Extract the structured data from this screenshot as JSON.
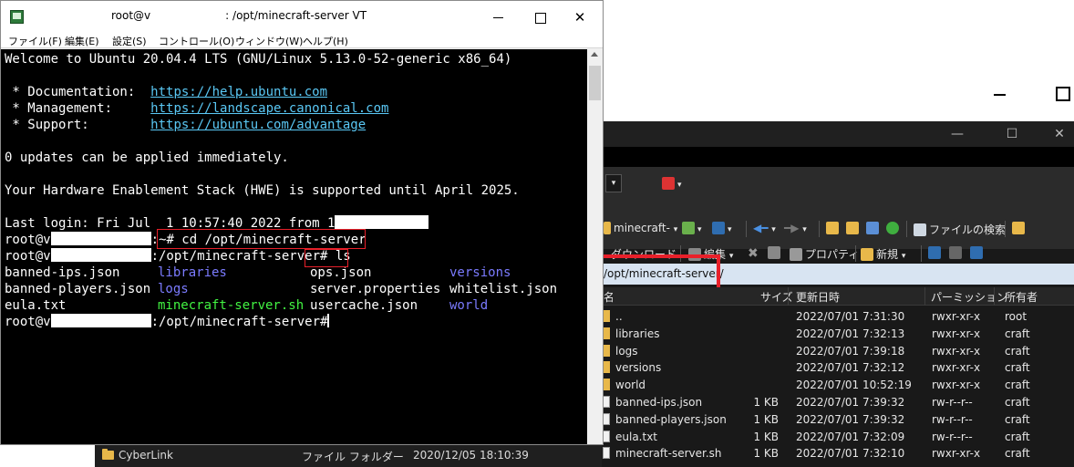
{
  "terminal": {
    "title_prefix": "root@v",
    "title_suffix": ": /opt/minecraft-server VT",
    "menu": [
      "ファイル(F)",
      "編集(E)",
      "設定(S)",
      "コントロール(O)",
      "ウィンドウ(W)",
      "ヘルプ(H)"
    ],
    "close_glyph": "✕",
    "welcome": "Welcome to Ubuntu 20.04.4 LTS (GNU/Linux 5.13.0-52-generic x86_64)",
    "docs_label": " * Documentation:  ",
    "docs_url": "https://help.ubuntu.com",
    "mgmt_label": " * Management:     ",
    "mgmt_url": "https://landscape.canonical.com",
    "support_label": " * Support:        ",
    "support_url": "https://ubuntu.com/advantage",
    "updates": "0 updates can be applied immediately.",
    "hwe": "Your Hardware Enablement Stack (HWE) is supported until April 2025.",
    "last_login": "Last login: Fri Jul  1 10:57:40 2022 from 1",
    "prompt_user": "root@v",
    "path_home": ":~",
    "cmd_cd": "# cd /opt/minecraft-server",
    "path_mc": ":/opt/minecraft-server",
    "cmd_ls": "# ls",
    "prompt_end": "#",
    "ls": {
      "col1": [
        "banned-ips.json",
        "banned-players.json",
        "eula.txt"
      ],
      "col2": [
        "libraries",
        "logs",
        "minecraft-server.sh"
      ],
      "col3": [
        "ops.json",
        "server.properties",
        "usercache.json"
      ],
      "col4": [
        "versions",
        "whitelist.json",
        "world"
      ]
    }
  },
  "background_row": {
    "name": "CyberLink",
    "type": "ファイル フォルダー",
    "date": "2020/12/05  18:10:39"
  },
  "file_manager": {
    "close_glyph": "✕",
    "folder_dropdown": "minecraft-",
    "search_label": "ファイルの検索",
    "download_label": "ダウンロード",
    "edit_label": "編集",
    "properties_label": "プロパティ",
    "new_label": "新規",
    "path": "/opt/minecraft-server/",
    "headers": {
      "name": "名前",
      "size": "サイズ",
      "modified": "更新日時",
      "permissions": "パーミッション",
      "owner": "所有者"
    },
    "rows": [
      {
        "name": "..",
        "size": "",
        "modified": "2022/07/01 7:31:30",
        "permissions": "rwxr-xr-x",
        "owner": "root",
        "kind": "folder"
      },
      {
        "name": "libraries",
        "size": "",
        "modified": "2022/07/01 7:32:13",
        "permissions": "rwxr-xr-x",
        "owner": "craft",
        "kind": "folder"
      },
      {
        "name": "logs",
        "size": "",
        "modified": "2022/07/01 7:39:18",
        "permissions": "rwxr-xr-x",
        "owner": "craft",
        "kind": "folder"
      },
      {
        "name": "versions",
        "size": "",
        "modified": "2022/07/01 7:32:12",
        "permissions": "rwxr-xr-x",
        "owner": "craft",
        "kind": "folder"
      },
      {
        "name": "world",
        "size": "",
        "modified": "2022/07/01 10:52:19",
        "permissions": "rwxr-xr-x",
        "owner": "craft",
        "kind": "folder"
      },
      {
        "name": "banned-ips.json",
        "size": "1 KB",
        "modified": "2022/07/01 7:39:32",
        "permissions": "rw-r--r--",
        "owner": "craft",
        "kind": "file"
      },
      {
        "name": "banned-players.json",
        "size": "1 KB",
        "modified": "2022/07/01 7:39:32",
        "permissions": "rw-r--r--",
        "owner": "craft",
        "kind": "file"
      },
      {
        "name": "eula.txt",
        "size": "1 KB",
        "modified": "2022/07/01 7:32:09",
        "permissions": "rw-r--r--",
        "owner": "craft",
        "kind": "file"
      },
      {
        "name": "minecraft-server.sh",
        "size": "1 KB",
        "modified": "2022/07/01 7:32:10",
        "permissions": "rwxr-xr-x",
        "owner": "craft",
        "kind": "file"
      }
    ]
  },
  "colors": {
    "terminal_bg": "#000000",
    "terminal_fg": "#ffffff",
    "link": "#5ac8f5",
    "directory": "#7b7bff",
    "executable": "#42f442",
    "highlight_box": "#e8202a",
    "path_bar": "#d8e4f2"
  }
}
